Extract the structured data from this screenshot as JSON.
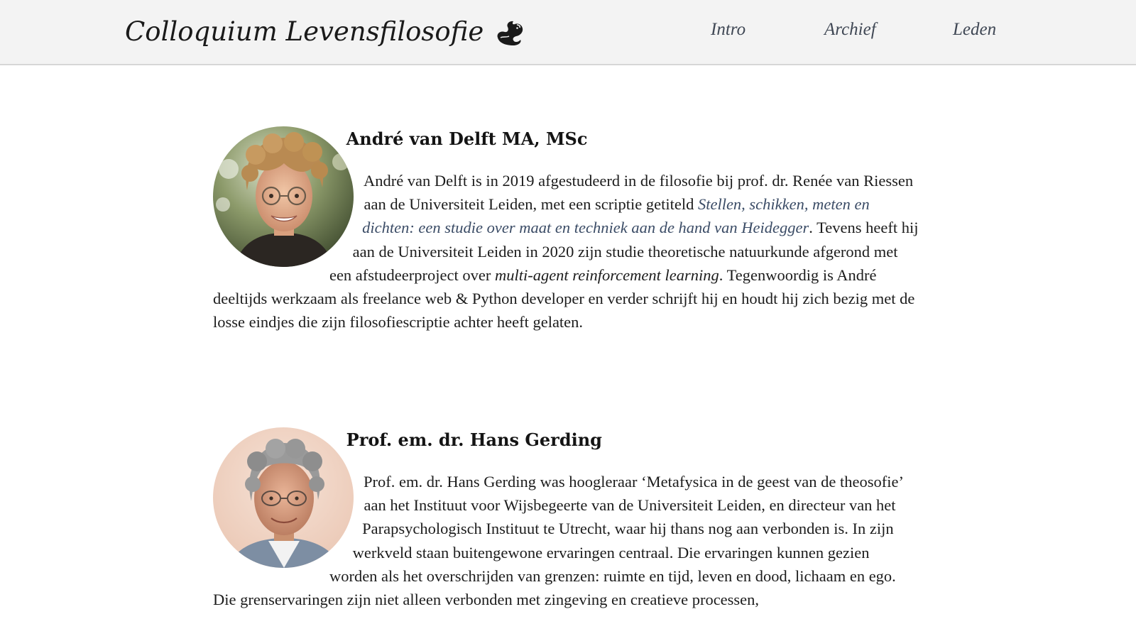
{
  "header": {
    "site_title": "Colloquium Levensfilosofie",
    "logo_icon": "horse-head-icon",
    "nav": [
      {
        "label": "Intro"
      },
      {
        "label": "Archief"
      },
      {
        "label": "Leden"
      }
    ]
  },
  "members": [
    {
      "name": "André van Delft MA, MSc",
      "photo": "portrait-young-man-curly-hair-glasses",
      "bio_part1": "André van Delft is in 2019 afgestudeerd in de filosofie bij prof. dr. Renée van Riessen aan de Universiteit Leiden, met een scriptie getiteld ",
      "bio_thesis_link": "Stellen, schikken, meten en dichten: een studie over maat en techniek aan de hand van Heidegger",
      "bio_part2": ". Tevens heeft hij aan de Universiteit Leiden in 2020 zijn studie theoretische natuurkunde afgerond met een afstudeerproject over ",
      "bio_emphasis": "multi-agent reinforcement learning",
      "bio_part3": ". Tegenwoordig is André deeltijds werkzaam als freelance web & Python developer en verder schrijft hij en houdt hij zich bezig met de losse eindjes die zijn filosofiescriptie achter heeft gelaten."
    },
    {
      "name": "Prof. em. dr. Hans Gerding",
      "photo": "portrait-older-man-grey-hair-glasses",
      "bio": "Prof. em. dr. Hans Gerding was hoogleraar ‘Metafysica in de geest van de theosofie’ aan het Instituut voor Wijsbegeerte van de Universiteit Leiden, en directeur van het Parapsychologisch Instituut te Utrecht, waar hij thans nog aan verbonden is. In zijn werkveld staan buitengewone ervaringen centraal. Die ervaringen kunnen gezien worden als het overschrijden van grenzen: ruimte en tijd, leven en dood, lichaam en ego. Die grenservaringen zijn niet alleen verbonden met zingeving en creatieve processen,"
    }
  ],
  "colors": {
    "header_bg": "#f3f3f3",
    "nav_text": "#3f4754",
    "link_text": "#3b4c66",
    "body_text": "#1c1c1c"
  }
}
